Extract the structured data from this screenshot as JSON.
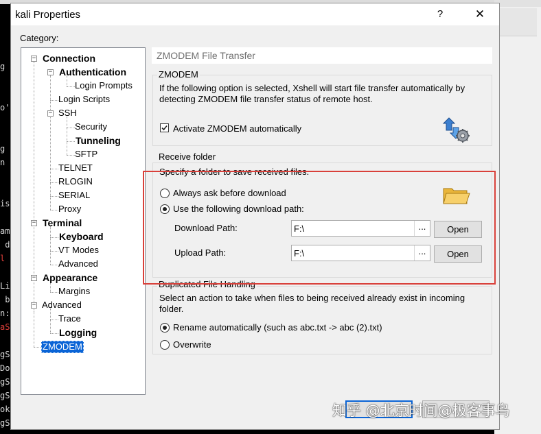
{
  "dialog": {
    "title": "kali Properties",
    "help_label": "?",
    "close_label": "✕"
  },
  "category_label": "Category:",
  "tree": {
    "connection": "Connection",
    "authentication": "Authentication",
    "login_prompts": "Login Prompts",
    "login_scripts": "Login Scripts",
    "ssh": "SSH",
    "security": "Security",
    "tunneling": "Tunneling",
    "sftp": "SFTP",
    "telnet": "TELNET",
    "rlogin": "RLOGIN",
    "serial": "SERIAL",
    "proxy": "Proxy",
    "terminal": "Terminal",
    "keyboard": "Keyboard",
    "vt_modes": "VT Modes",
    "advanced": "Advanced",
    "appearance": "Appearance",
    "margins": "Margins",
    "advanced2": "Advanced",
    "trace": "Trace",
    "logging": "Logging",
    "zmodem": "ZMODEM",
    "expanded_glyph": "−"
  },
  "panel": {
    "header": "ZMODEM File Transfer",
    "zmodem_group": {
      "label": "ZMODEM",
      "desc_line1": "If the following option is selected, Xshell will start file transfer automatically by",
      "desc_line2": "detecting ZMODEM file transfer status of remote host.",
      "activate_label": "Activate ZMODEM automatically",
      "activate_checked": true
    },
    "receive_group": {
      "label": "Receive folder",
      "desc": "Specify a folder to save received files.",
      "option_ask": "Always ask before download",
      "option_path": "Use the following download path:",
      "selected": "path",
      "download_label": "Download Path:",
      "download_value": "F:\\",
      "upload_label": "Upload Path:",
      "upload_value": "F:\\",
      "browse_label": "...",
      "open_label": "Open"
    },
    "duplicate_group": {
      "label": "Duplicated File Handling",
      "desc_line1": "Select an action to take when files to being received already exist in incoming",
      "desc_line2": "folder.",
      "option_rename": "Rename automatically (such as abc.txt -> abc (2).txt)",
      "option_overwrite": "Overwrite",
      "selected": "rename"
    }
  },
  "watermark": "知乎 @北京时间@极客事鸟",
  "terminal_lines": [
    "g t",
    "  co",
    "",
    "o'",
    "",
    "",
    "g t",
    "n e",
    "  to",
    "",
    "isS",
    "",
    "ama",
    " di",
    "l i",
    "",
    "Lin",
    " by",
    "n:",
    "aSc",
    "",
    "gSc",
    "Doc",
    "gSc",
    "gSc",
    "ok",
    "gSc"
  ],
  "colors": {
    "highlight": "#d9403a",
    "selection": "#0a64d6"
  }
}
